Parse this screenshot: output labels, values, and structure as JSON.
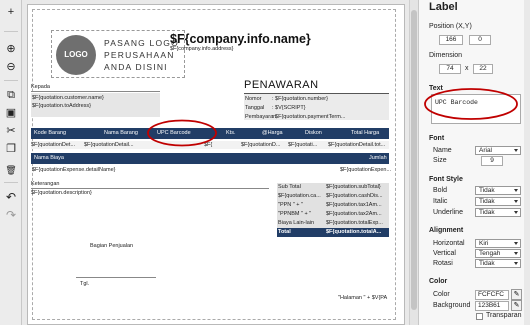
{
  "toolbar": {
    "icons": [
      "plus-icon",
      "zoom-in-icon",
      "zoom-out-icon",
      "copy-icon",
      "paste-icon",
      "cut-icon",
      "duplicate-icon",
      "delete-icon",
      "undo-icon",
      "redo-icon"
    ],
    "glyphs": [
      "+",
      "⊕",
      "⊖",
      "⧉",
      "▣",
      "✂",
      "❐",
      "🗑",
      "↶",
      "↷"
    ]
  },
  "report": {
    "company_name": "$F{company.info.name}",
    "company_address": "$F{company.info.address}",
    "logo_circle_text": "LOGO",
    "logo_text": [
      "PASANG LOGO",
      "PERUSAHAAN",
      "ANDA DISINI"
    ],
    "doc_title": "PENAWARAN",
    "kepada_label": "Kepada",
    "customer_name": "$F{quotation.customer.name}",
    "to_address": "$F{quotation.toAddress}",
    "meta": [
      {
        "label": "Nomor",
        "value": ": $F{quotation.number}"
      },
      {
        "label": "Tanggal",
        "value": ": $V{SCRIPT}"
      },
      {
        "label": "Pembayaran",
        "value": ": $F{quotation.paymentTerm..."
      }
    ],
    "columns": [
      "Kode Barang",
      "Nama Barang",
      "UPC Barcode",
      "Kts.",
      "@Harga",
      "Diskon",
      "Total Harga"
    ],
    "detail_row": [
      "$F{quotationDet...",
      "$F{quotationDetail...",
      "",
      "$F{",
      "$F{quotationD...",
      "$F{quotati...",
      "$F{quotationDetail.tot..."
    ],
    "expense_header": {
      "left": "Nama Biaya",
      "right": "Jumlah"
    },
    "expense_row": {
      "left": "$F{quotationExpense.detailName}",
      "right": "$F{quotationExpen..."
    },
    "keterangan_label": "Keterangan",
    "description": "$F{quotation.description}",
    "summary": [
      {
        "label": "Sub Total",
        "value": "$F{quotation.subTotal}"
      },
      {
        "label": "$F{quotation.ca...",
        "value": "$F{quotation.cashDis..."
      },
      {
        "label": "\"PPN \" + \"",
        "value": "$F{quotation.tax1Am..."
      },
      {
        "label": "\"PPNBM \" + \"",
        "value": "$F{quotation.tax2Am..."
      },
      {
        "label": "Biaya Lain-lain",
        "value": "$F{quotation.totalExp..."
      },
      {
        "label": "Total",
        "value": "$F{quotation.totalA..."
      }
    ],
    "signature_label": "Bagian Penjualan",
    "tgl_label": "Tgl.",
    "footer_text": "\"Halaman \" + $V{PA"
  },
  "panel": {
    "title": "Label",
    "position_label": "Position (X,Y)",
    "pos_x": "166",
    "pos_y": "0",
    "dimension_label": "Dimension",
    "dim_w": "74",
    "dim_sep": "x",
    "dim_h": "22",
    "text_label": "Text",
    "text_value": "UPC Barcode",
    "font_label": "Font",
    "font_name_label": "Name",
    "font_name": "Arial",
    "font_size_label": "Size",
    "font_size": "9",
    "font_style_label": "Font Style",
    "bold_label": "Bold",
    "bold": "Tidak",
    "italic_label": "Italic",
    "italic": "Tidak",
    "underline_label": "Underline",
    "underline": "Tidak",
    "alignment_label": "Alignment",
    "horizontal_label": "Horizontal",
    "horizontal": "Kiri",
    "vertical_label": "Vertical",
    "vertical": "Tengah",
    "rotation_label": "Rotasi",
    "rotation": "Tidak",
    "color_label": "Color",
    "color_label2": "Color",
    "color_value": "FCFCFC",
    "background_label": "Background",
    "background_value": "123B61",
    "transparent_label": "Transparan",
    "pen_icon": "✎"
  },
  "colors": {
    "header_bar": "#213d66",
    "annotation": "#c00000"
  }
}
